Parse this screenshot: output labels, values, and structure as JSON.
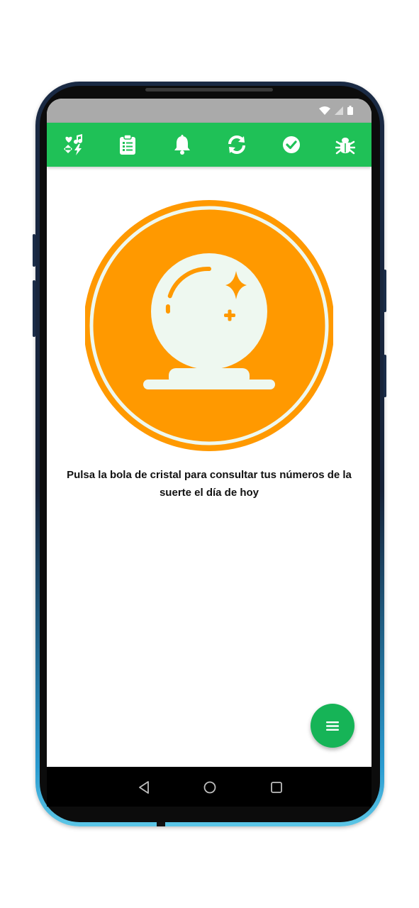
{
  "toolbar": {
    "items": [
      {
        "icon": "favorites-shuffle-icon"
      },
      {
        "icon": "clipboard-list-icon"
      },
      {
        "icon": "bell-icon"
      },
      {
        "icon": "refresh-icon"
      },
      {
        "icon": "check-circle-icon"
      },
      {
        "icon": "bug-icon"
      }
    ],
    "background_color": "#1fc157",
    "icon_color": "#ffffff"
  },
  "main": {
    "hint_text": "Pulsa la bola de cristal para consultar tus números de la suerte el día de hoy",
    "ball_icon": "crystal-ball-icon",
    "ball_color": "#ff9900",
    "ring_color": "#eef8f0"
  },
  "fab": {
    "icon": "menu-icon",
    "color": "#16b457"
  },
  "system_nav": {
    "buttons": [
      "back-icon",
      "home-icon",
      "recents-icon"
    ]
  },
  "status_bar": {
    "icons": [
      "wifi-icon",
      "signal-icon",
      "battery-icon"
    ]
  }
}
